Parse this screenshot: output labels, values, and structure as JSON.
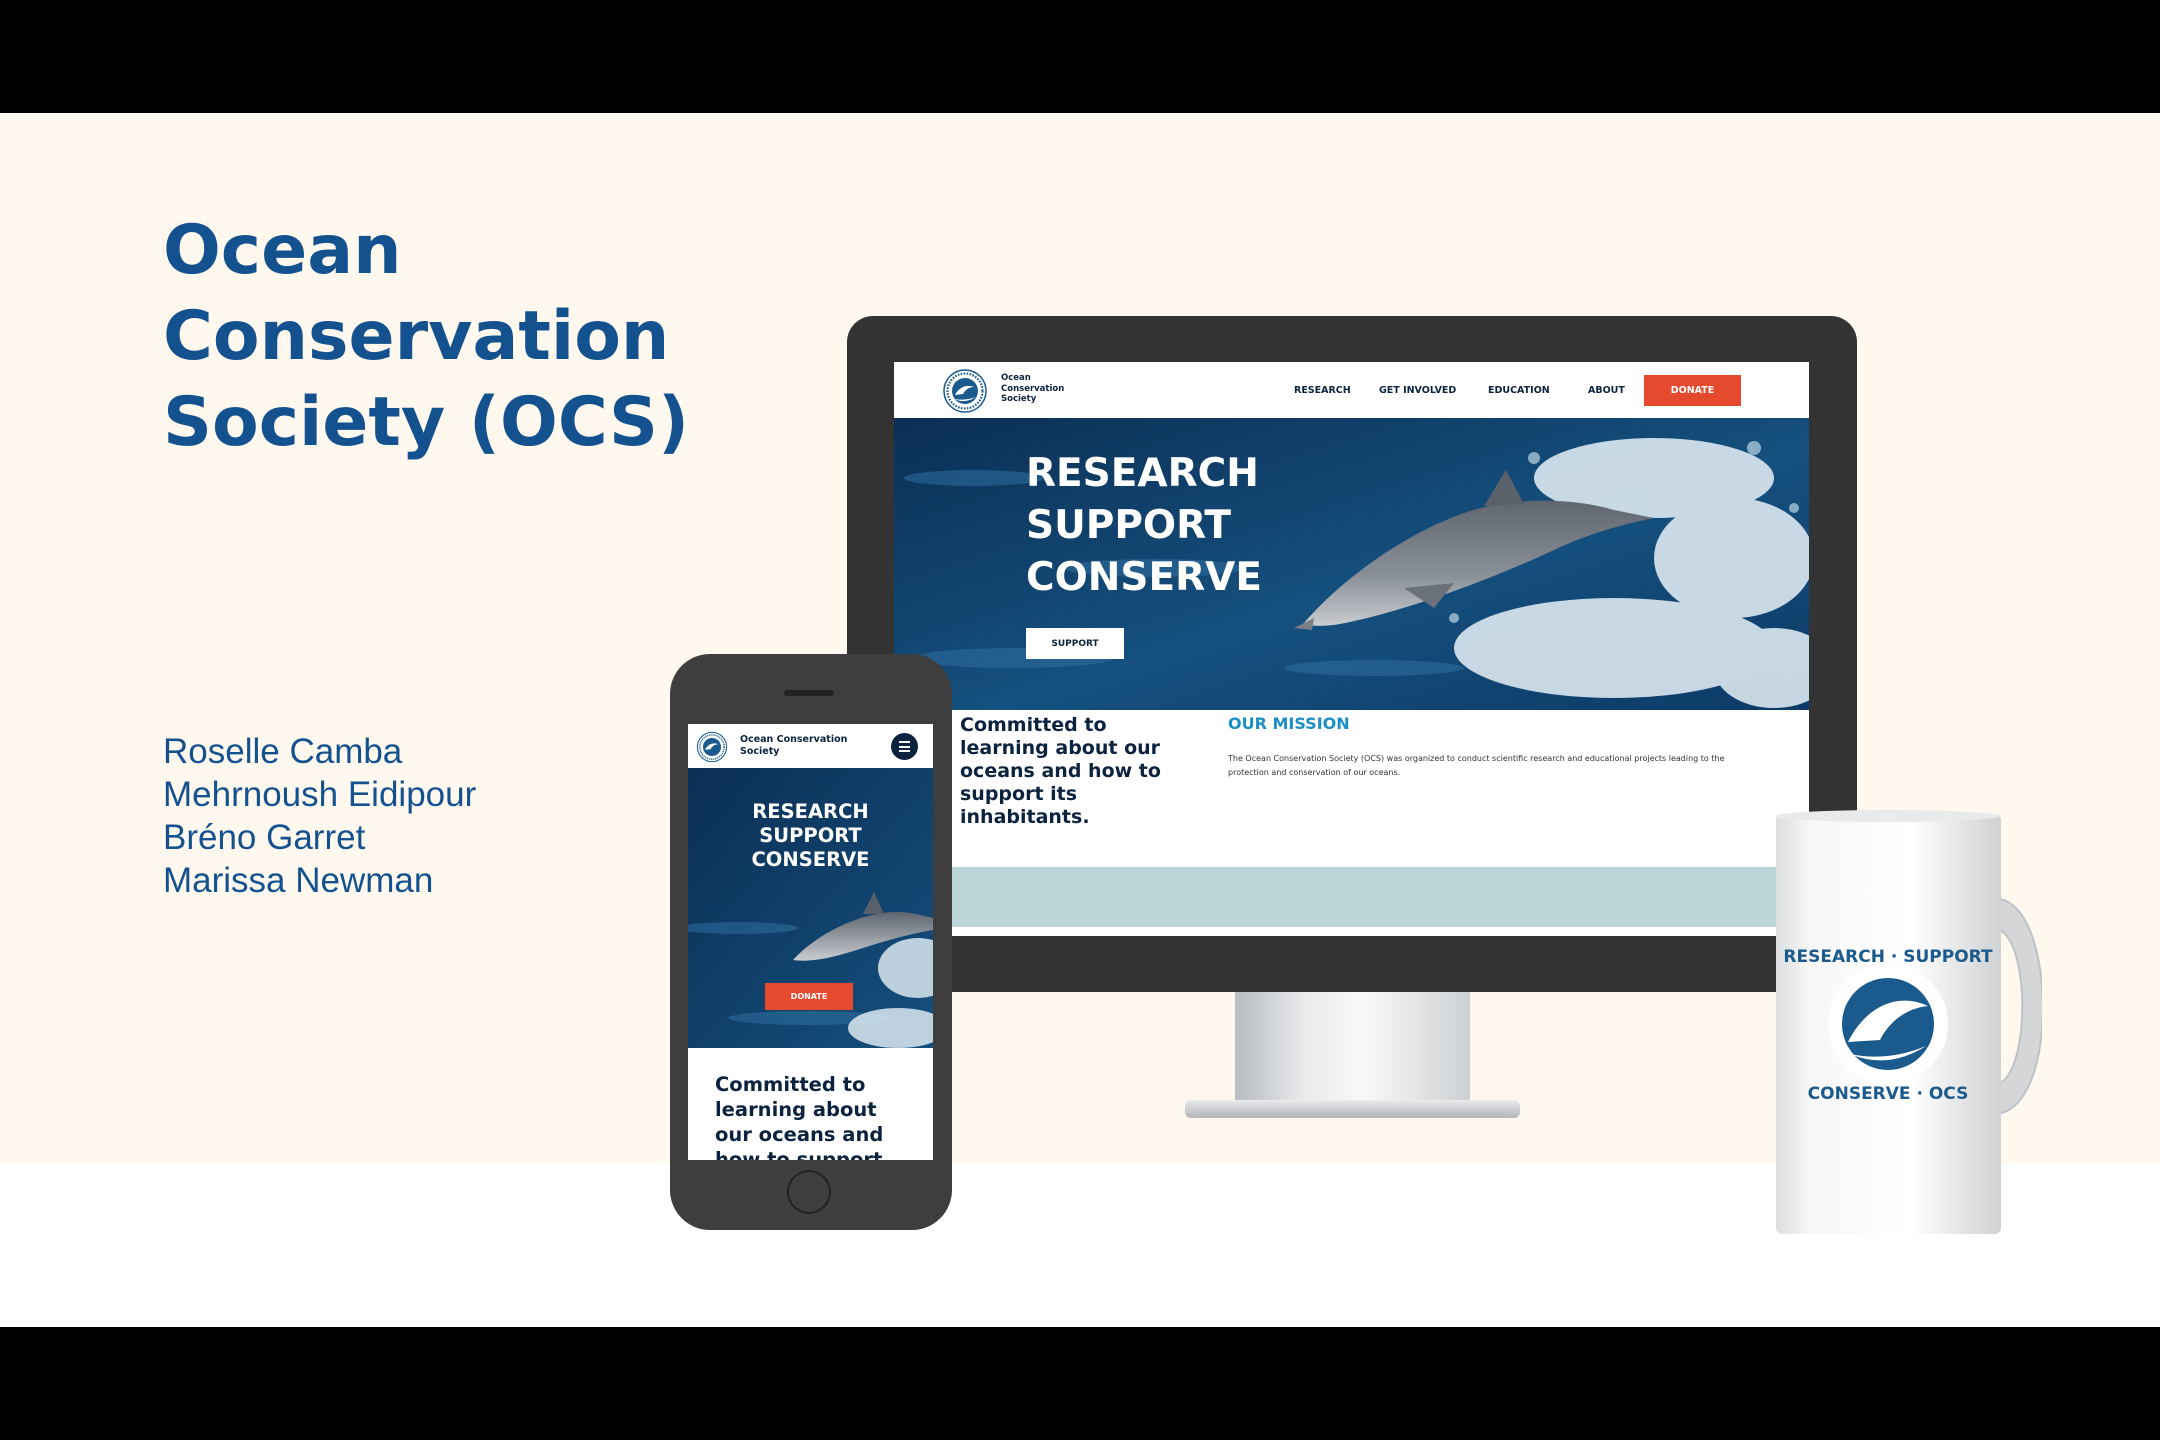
{
  "slide": {
    "title": "Ocean Conservation Society (OCS)",
    "authors": [
      "Roselle Camba",
      "Mehrnoush Eidipour",
      "Bréno Garret",
      "Marissa Newman"
    ]
  },
  "desktop": {
    "brand": "Ocean Conservation Society",
    "nav_links": [
      "RESEARCH",
      "GET INVOLVED",
      "EDUCATION",
      "ABOUT"
    ],
    "donate_label": "DONATE",
    "hero_lines": [
      "RESEARCH",
      "SUPPORT",
      "CONSERVE"
    ],
    "support_label": "SUPPORT",
    "tagline": "Committed to learning about our oceans and how to support its inhabitants.",
    "mission_heading": "OUR MISSION",
    "mission_text": "The Ocean Conservation Society (OCS) was organized to conduct scientific research and educational projects leading to the protection and conservation of our oceans."
  },
  "mobile": {
    "brand": "Ocean Conservation Society",
    "hero_lines": [
      "RESEARCH",
      "SUPPORT",
      "CONSERVE"
    ],
    "donate_label": "DONATE",
    "tagline": "Committed to learning about our oceans and how to support"
  },
  "mug": {
    "logo_text": [
      "RESEARCH · SUPPORT",
      "CONSERVE · OCS"
    ]
  },
  "colors": {
    "title_blue": "#14528f",
    "navy": "#0c2340",
    "donate_orange": "#e64a2e",
    "mission_blue": "#1b8fc4",
    "cream_background": "#fff8ee"
  }
}
